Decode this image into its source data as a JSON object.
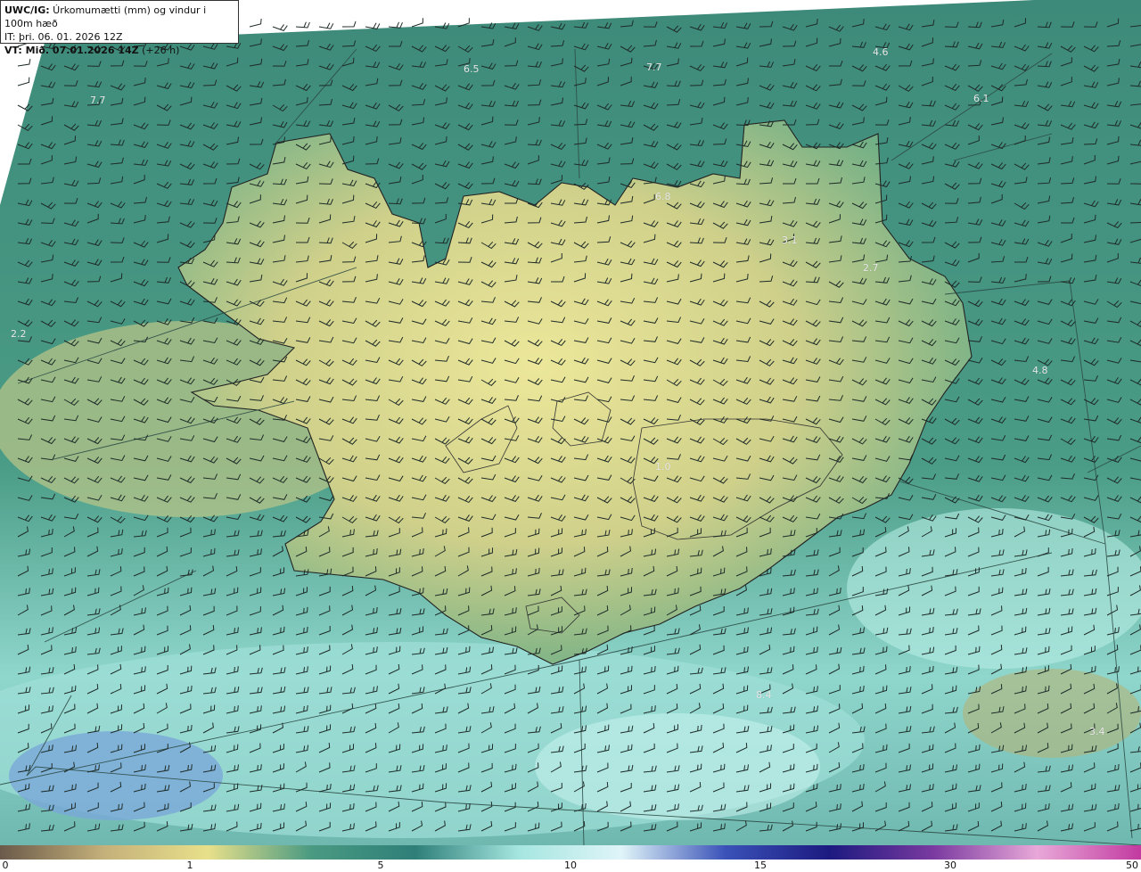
{
  "header": {
    "line1_bold": "UWC/IG:",
    "line1_text": " Úrkomumætti (mm) og vindur i 100m hæð",
    "line2": "IT: þri. 06. 01. 2026 12Z",
    "line3_bold": "VT: Mið. 07.01.2026 14Z",
    "line3_text": " (+26 h)"
  },
  "value_labels": [
    "7.7",
    "6.5",
    "7.7",
    "4.6",
    "6.1",
    "6.8",
    "3.1",
    "2.7",
    "2.2",
    "4.8",
    "1.0",
    "3.4",
    "8.4"
  ],
  "colorbar": {
    "ticks": [
      "0",
      "1",
      "5",
      "10",
      "15",
      "30",
      "50"
    ],
    "colors": [
      "#6b5a4a",
      "#c4b07a",
      "#e8e08a",
      "#4a9a82",
      "#2f7f79",
      "#a6e6e0",
      "#dff4f8",
      "#3a52b8",
      "#1c1a80",
      "#7a3aa0",
      "#e8a8d8",
      "#c23aa0"
    ]
  },
  "map": {
    "ocean_color": "#3f8f7f",
    "land_color": "#d9d88e"
  }
}
